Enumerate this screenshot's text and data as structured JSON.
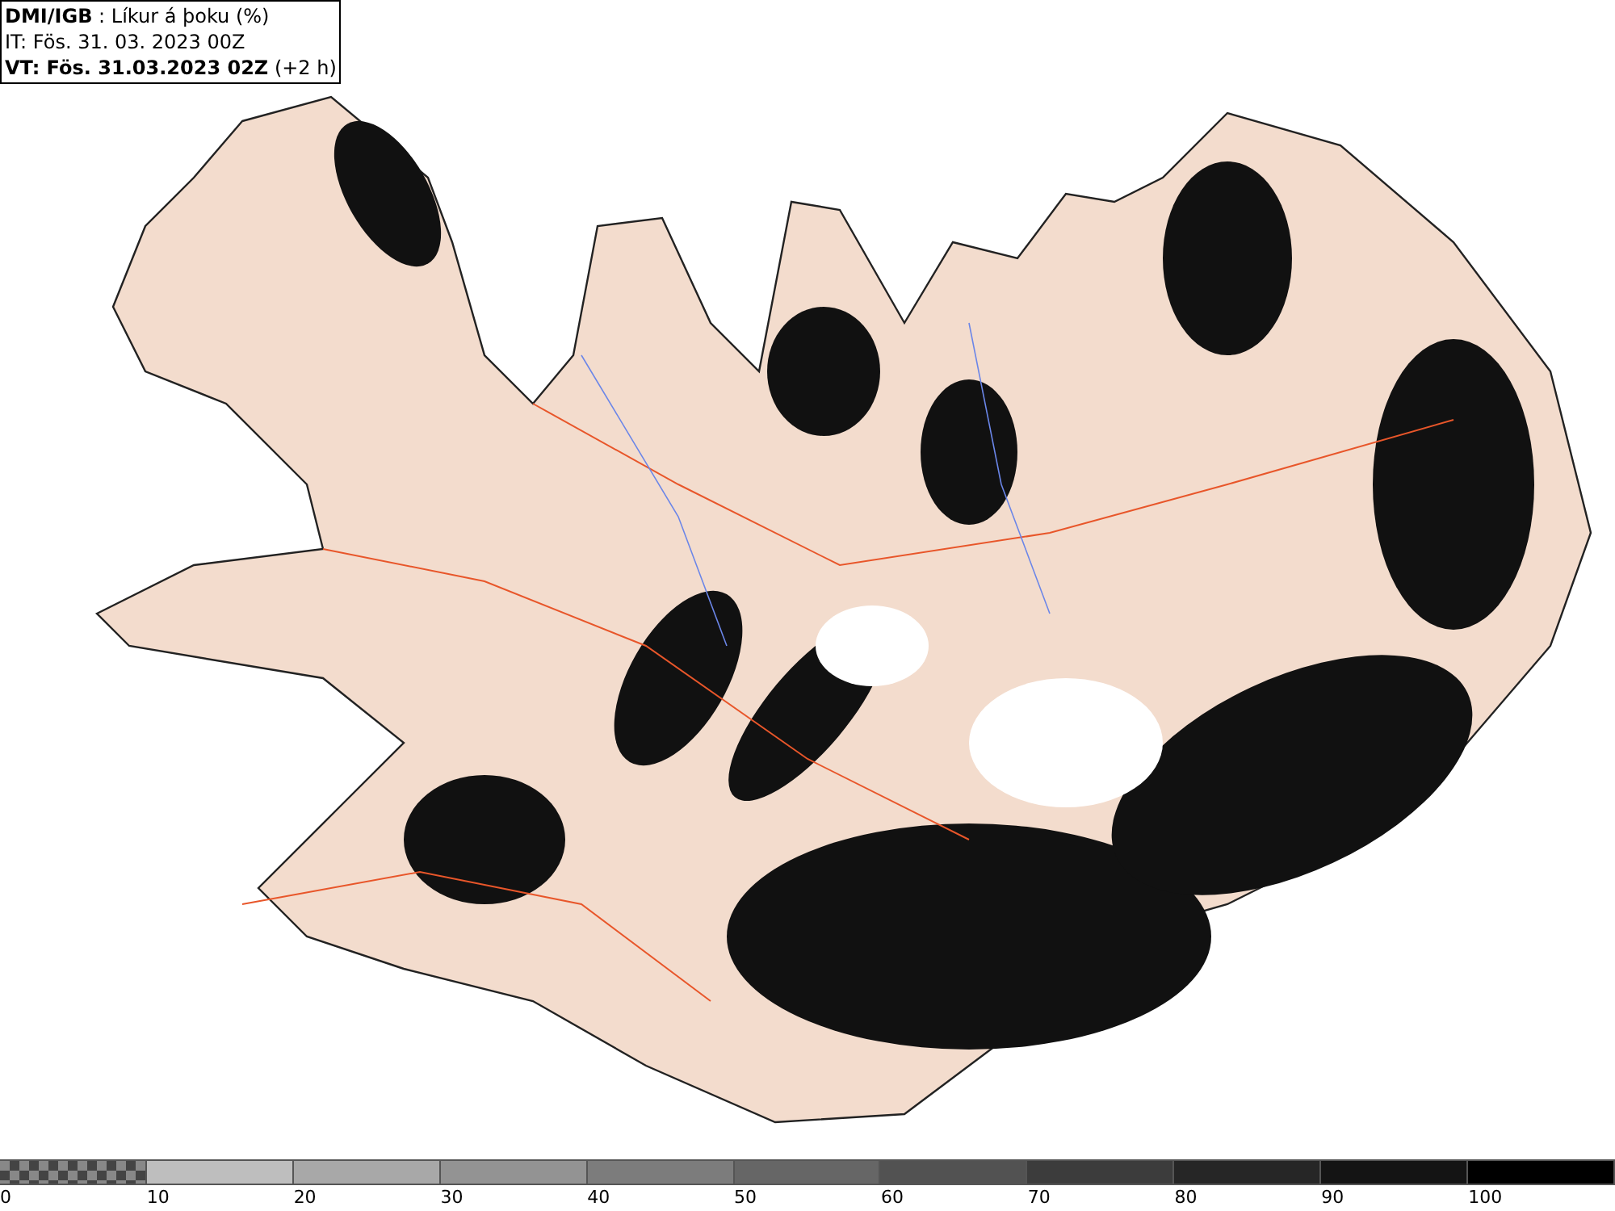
{
  "header": {
    "lines": [
      "**DMI/IGB** : Líkur á þoku (%)",
      "IT: Fös. 31. 03. 2023 00Z",
      "**VT: Fös. 31.03.2023 02Z** (+2 h)"
    ]
  },
  "legend": {
    "segments": [
      {
        "kind": "checker",
        "label": "0"
      },
      {
        "kind": "solid",
        "color": "#bebebe",
        "label": "10"
      },
      {
        "kind": "solid",
        "color": "#a8a8a8",
        "label": "20"
      },
      {
        "kind": "solid",
        "color": "#939393",
        "label": "30"
      },
      {
        "kind": "solid",
        "color": "#7c7c7c",
        "label": "40"
      },
      {
        "kind": "solid",
        "color": "#666666",
        "label": "50"
      },
      {
        "kind": "solid",
        "color": "#525252",
        "label": "60"
      },
      {
        "kind": "solid",
        "color": "#3c3c3c",
        "label": "70"
      },
      {
        "kind": "solid",
        "color": "#262626",
        "label": "80"
      },
      {
        "kind": "solid",
        "color": "#141414",
        "label": "90"
      },
      {
        "kind": "solid",
        "color": "#000000",
        "label": "100"
      }
    ]
  }
}
